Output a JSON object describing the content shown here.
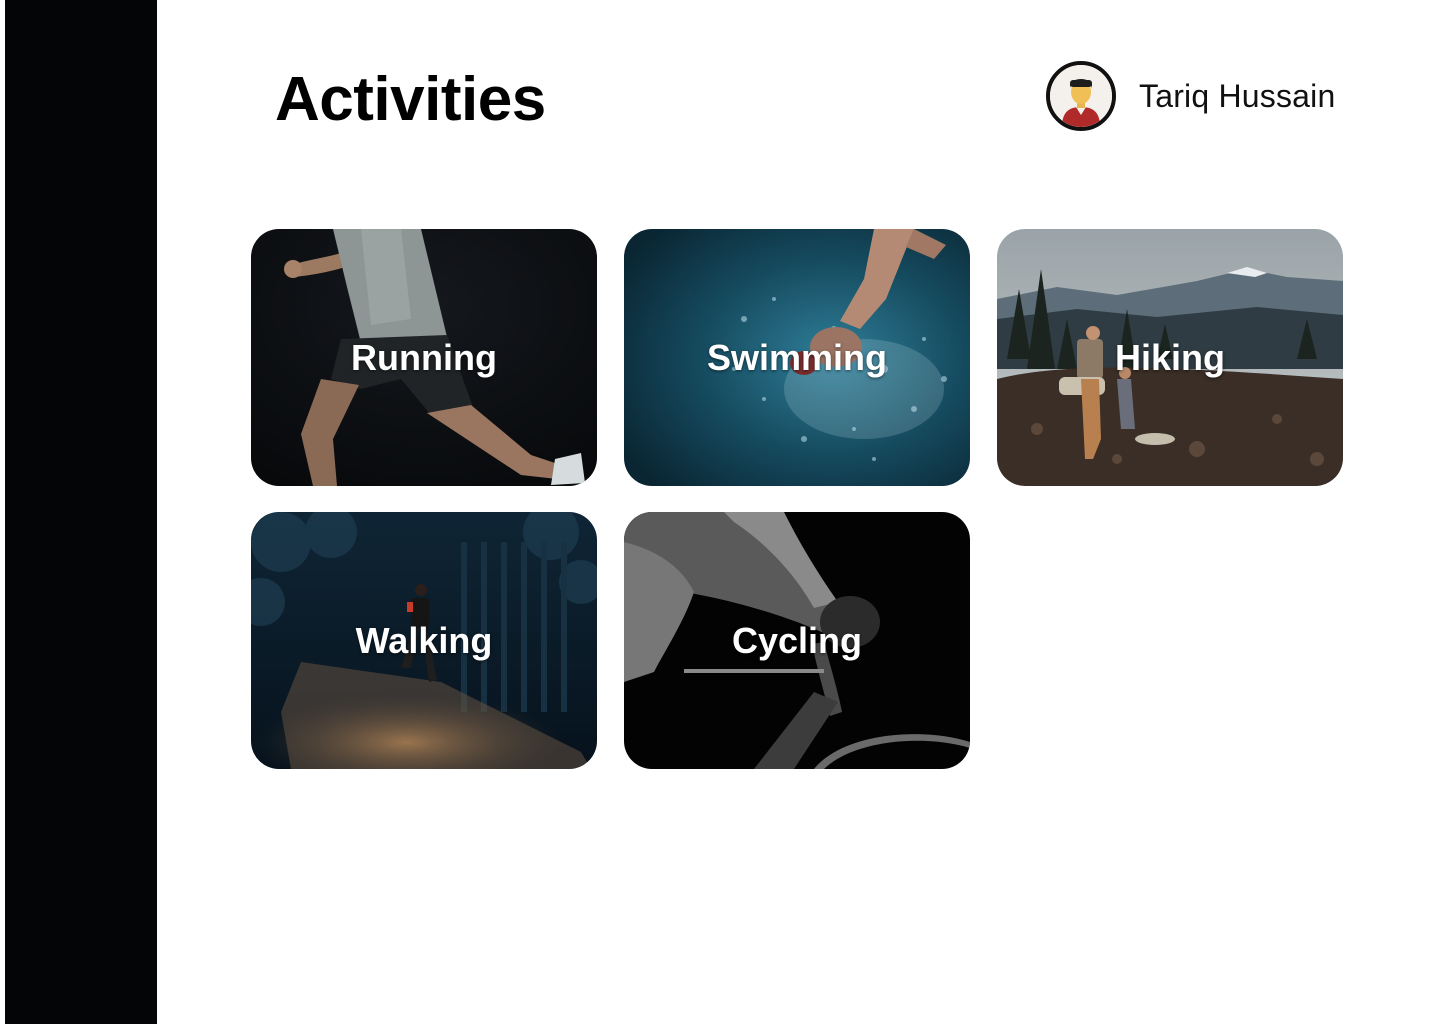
{
  "page": {
    "title": "Activities"
  },
  "user": {
    "name": "Tariq Hussain",
    "avatar_icon": "person-avatar-icon"
  },
  "activities": [
    {
      "label": "Running",
      "image": "runner-photo"
    },
    {
      "label": "Swimming",
      "image": "swimmer-photo"
    },
    {
      "label": "Hiking",
      "image": "hikers-mountain-photo"
    },
    {
      "label": "Walking",
      "image": "night-walker-photo"
    },
    {
      "label": "Cycling",
      "image": "cyclist-photo"
    }
  ],
  "colors": {
    "sidebar": "#040507",
    "background": "#ffffff",
    "text": "#000000",
    "card_label": "#ffffff"
  }
}
